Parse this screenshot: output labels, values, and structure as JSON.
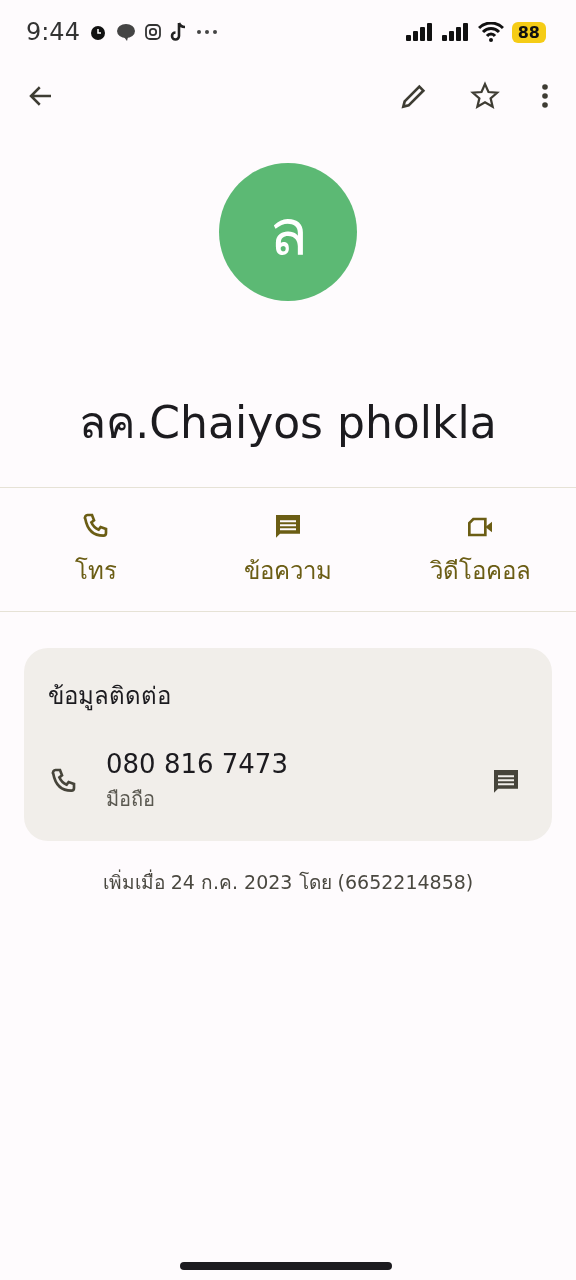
{
  "status_bar": {
    "time": "9:44",
    "battery": "88"
  },
  "contact": {
    "initial": "ล",
    "name": "ลค.Chaiyos pholkla"
  },
  "actions": [
    {
      "kind": "call",
      "label": "โทร"
    },
    {
      "kind": "message",
      "label": "ข้อความ"
    },
    {
      "kind": "video",
      "label": "วิดีโอคอล"
    }
  ],
  "contact_info": {
    "title": "ข้อมูลติดต่อ",
    "phones": [
      {
        "number": "080 816 7473",
        "type": "มือถือ"
      }
    ]
  },
  "footer": "เพิ่มเมื่อ 24 ก.ค. 2023 โดย (6652214858)"
}
